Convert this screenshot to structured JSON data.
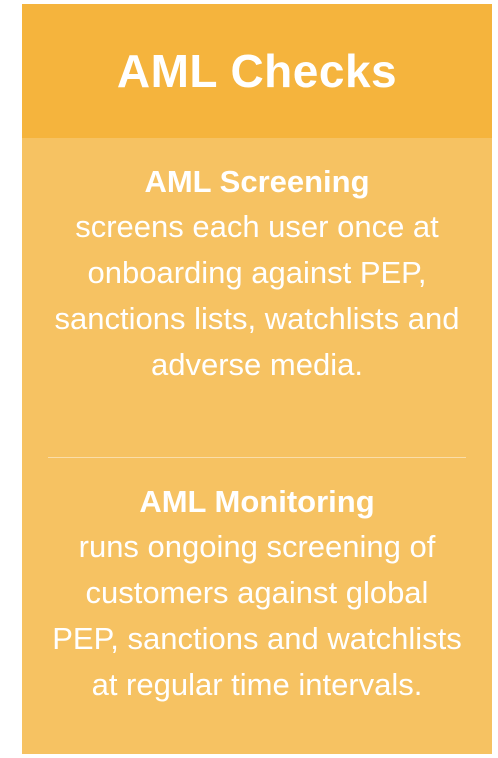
{
  "card": {
    "title": "AML Checks",
    "sections": [
      {
        "heading": "AML Screening",
        "body": "screens each user once at onboarding against PEP, sanctions lists, watchlists and adverse media."
      },
      {
        "heading": "AML Monitoring",
        "body": "runs ongoing screening of customers against global PEP, sanctions and watchlists at regular time intervals."
      }
    ]
  },
  "colors": {
    "header_background": "#f5b43d",
    "body_background": "#f6c262",
    "text": "#ffffff"
  }
}
